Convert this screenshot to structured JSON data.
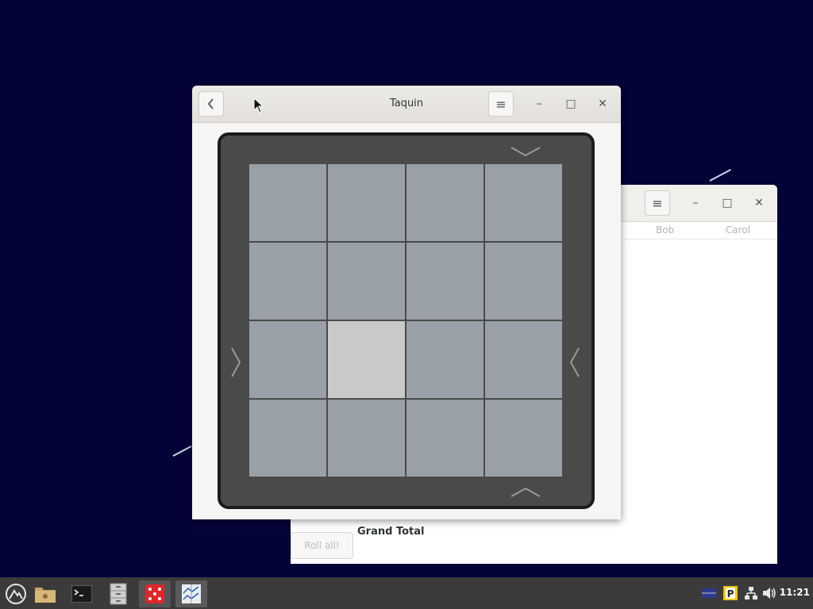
{
  "main_window": {
    "title": "Taquin",
    "back_icon": "chevron-left-icon",
    "menu_icon": "hamburger-menu-icon",
    "minimize_icon": "minimize-icon",
    "maximize_icon": "maximize-icon",
    "close_icon": "close-icon",
    "board": {
      "size": "4x4",
      "empty_cell": {
        "row": 3,
        "col": 2
      },
      "tile_image": "cat-photo-fragments",
      "arrows": [
        "arrow-down-icon",
        "arrow-up-icon",
        "arrow-left-icon",
        "arrow-right-icon"
      ]
    }
  },
  "background_window": {
    "columns": [
      "Bob",
      "Carol"
    ],
    "grand_total_label": "Grand Total",
    "roll_button_label": "Roll all!",
    "menu_icon": "hamburger-menu-icon",
    "minimize_icon": "minimize-icon",
    "maximize_icon": "maximize-icon",
    "close_icon": "close-icon"
  },
  "panel": {
    "launchers": [
      "app-menu-icon",
      "file-manager-icon",
      "terminal-icon",
      "file-cabinet-icon",
      "dice-game-icon",
      "taquin-icon"
    ],
    "tray": [
      "keyboard-layout-icon",
      "parking-indicator-icon",
      "network-icon",
      "volume-icon"
    ],
    "clock": "11:21"
  },
  "colors": {
    "desktop": "#030338",
    "panel": "#3b3b3b",
    "board": "#4a4a4a",
    "empty_tile": "#c9c9c9"
  }
}
